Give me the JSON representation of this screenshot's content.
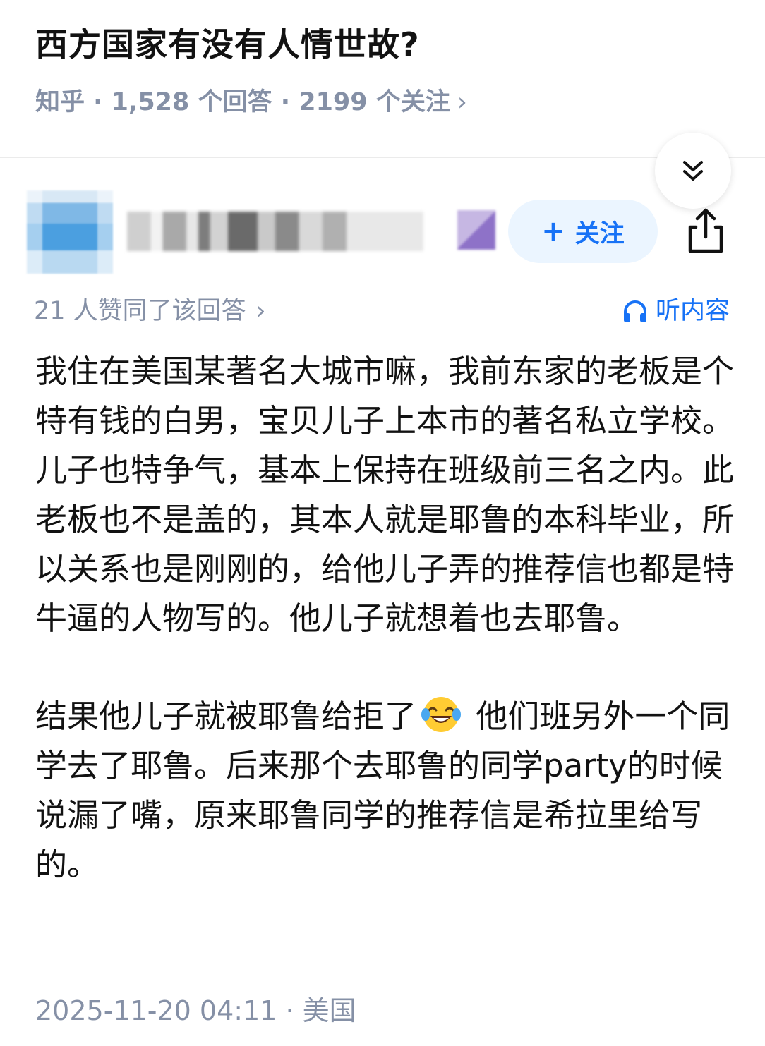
{
  "question": {
    "title": "西方国家有没有人情世故?",
    "meta": "知乎 · 1,528 个回答 · 2199 个关注",
    "meta_chevron": "›"
  },
  "author": {
    "follow_label": "关注",
    "follow_plus": "+"
  },
  "answer": {
    "votes_text": "21 人赞同了该回答",
    "votes_chevron": "›",
    "listen_label": "听内容",
    "paragraph_1": "我住在美国某著名大城市嘛，我前东家的老板是个特有钱的白男，宝贝儿子上本市的著名私立学校。儿子也特争气，基本上保持在班级前三名之内。此老板也不是盖的，其本人就是耶鲁的本科毕业，所以关系也是刚刚的，给他儿子弄的推荐信也都是特牛逼的人物写的。他儿子就想着也去耶鲁。",
    "paragraph_2a": "结果他儿子就被耶鲁给拒了",
    "paragraph_2b": " 他们班另外一个同学去了耶鲁。后来那个去耶鲁的同学party的时候说漏了嘴，原来耶鲁同学的推荐信是希拉里给写的。",
    "footer": "2025-11-20 04:11 · 美国"
  },
  "icons": {
    "collapse": "double-chevron-down-icon",
    "share": "share-icon",
    "headphones": "headphones-icon",
    "emoji": "laughing-tears-emoji"
  },
  "colors": {
    "accent": "#1772f6",
    "muted": "#8590a6",
    "text": "#121212",
    "follow_bg": "#ebf5ff"
  }
}
